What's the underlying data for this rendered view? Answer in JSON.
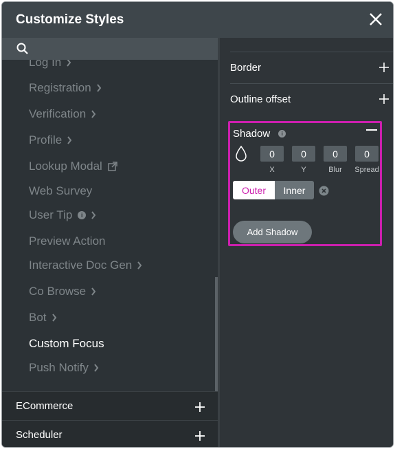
{
  "header": {
    "title": "Customize Styles"
  },
  "search": {
    "placeholder": ""
  },
  "nav": {
    "items": [
      {
        "label": "Log In",
        "has_chevron": true
      },
      {
        "label": "Registration",
        "has_chevron": true
      },
      {
        "label": "Verification",
        "has_chevron": true
      },
      {
        "label": "Profile",
        "has_chevron": true
      },
      {
        "label": "Lookup Modal",
        "icon": "external-link-icon"
      },
      {
        "label": "Web Survey"
      },
      {
        "label": "User Tip",
        "info": "i",
        "has_chevron": true
      },
      {
        "label": "Preview Action"
      },
      {
        "label": "Interactive Doc Gen",
        "has_chevron": true
      },
      {
        "label": "Co Browse",
        "has_chevron": true
      },
      {
        "label": "Bot",
        "has_chevron": true
      },
      {
        "label": "Custom Focus",
        "active": true
      },
      {
        "label": "Push Notify",
        "has_chevron": true
      }
    ]
  },
  "sections": [
    {
      "label": "ECommerce"
    },
    {
      "label": "Scheduler"
    }
  ],
  "properties": {
    "border_label": "Border",
    "outline_offset_label": "Outline offset"
  },
  "shadow": {
    "title": "Shadow",
    "info": "i",
    "fields": [
      {
        "label": "X",
        "value": "0"
      },
      {
        "label": "Y",
        "value": "0"
      },
      {
        "label": "Blur",
        "value": "0"
      },
      {
        "label": "Spread",
        "value": "0"
      }
    ],
    "toggle": {
      "outer": "Outer",
      "inner": "Inner",
      "selected": "Outer"
    },
    "remove": "x",
    "add_button": "Add Shadow"
  },
  "colors": {
    "accent": "#cc1fae",
    "header_bg": "#3e464b",
    "panel_bg": "#2f3438"
  }
}
